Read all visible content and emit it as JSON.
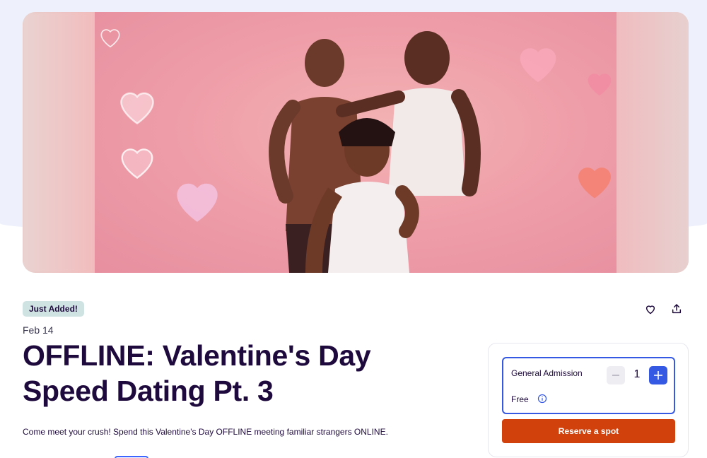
{
  "event": {
    "badge": "Just Added!",
    "date": "Feb 14",
    "title_line1": "OFFLINE: Valentine's Day",
    "title_line2": "Speed Dating Pt. 3",
    "description": "Come meet your crush! Spend this Valentine's Day OFFLINE meeting familiar strangers ONLINE."
  },
  "actions": {
    "like_icon": "heart-outline-icon",
    "share_icon": "share-upload-icon"
  },
  "ticket": {
    "name": "General Admission",
    "price": "Free",
    "quantity": "1",
    "reserve_label": "Reserve a spot"
  },
  "colors": {
    "brand_orange": "#d1410c",
    "accent_blue": "#3659e3",
    "title_navy": "#1e0a3c",
    "badge_bg": "#cfe3e3"
  }
}
